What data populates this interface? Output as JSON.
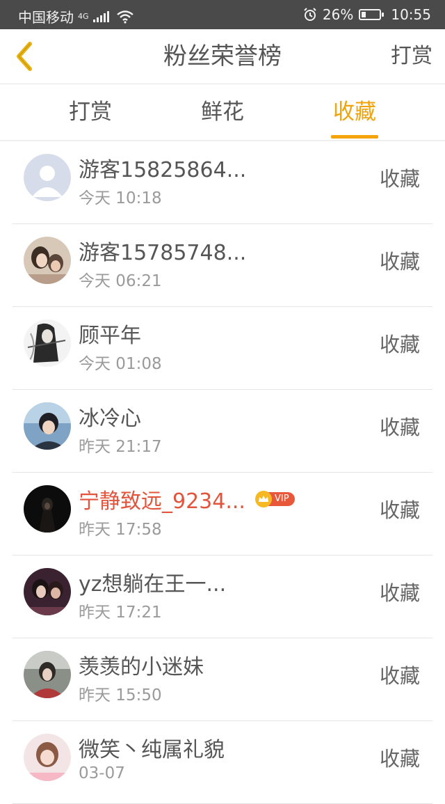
{
  "statusbar": {
    "carrier": "中国移动",
    "network": "4G",
    "battery_percent": "26%",
    "battery_level": 0.26,
    "time": "10:55"
  },
  "navbar": {
    "back_icon": "chevron-left-icon",
    "title": "粉丝荣誉榜",
    "right_action": "打赏"
  },
  "tabs": {
    "items": [
      "打赏",
      "鲜花",
      "收藏"
    ],
    "active_index": 2,
    "active_color": "#f5a40b"
  },
  "list": {
    "items": [
      {
        "name": "游客15825864...",
        "time": "今天 10:18",
        "action": "收藏",
        "vip": false,
        "avatar": "default-avatar"
      },
      {
        "name": "游客15785748...",
        "time": "今天 06:21",
        "action": "收藏",
        "vip": false,
        "avatar": "photo-avatar"
      },
      {
        "name": "顾平年",
        "time": "今天 01:08",
        "action": "收藏",
        "vip": false,
        "avatar": "photo-avatar"
      },
      {
        "name": "冰冷心",
        "time": "昨天 21:17",
        "action": "收藏",
        "vip": false,
        "avatar": "photo-avatar"
      },
      {
        "name": "宁静致远_9234...",
        "time": "昨天 17:58",
        "action": "收藏",
        "vip": true,
        "vip_label": "VIP",
        "avatar": "photo-avatar"
      },
      {
        "name": "yz想躺在王一...",
        "time": "昨天 17:21",
        "action": "收藏",
        "vip": false,
        "avatar": "photo-avatar"
      },
      {
        "name": "羡羡的小迷妹",
        "time": "昨天 15:50",
        "action": "收藏",
        "vip": false,
        "avatar": "photo-avatar"
      },
      {
        "name": "微笑丶纯属礼貌",
        "time": "03-07",
        "action": "收藏",
        "vip": false,
        "avatar": "photo-avatar"
      }
    ]
  },
  "colors": {
    "accent": "#f5a40b",
    "vip_name": "#e2543c",
    "statusbar_bg": "#4a4a4a"
  }
}
